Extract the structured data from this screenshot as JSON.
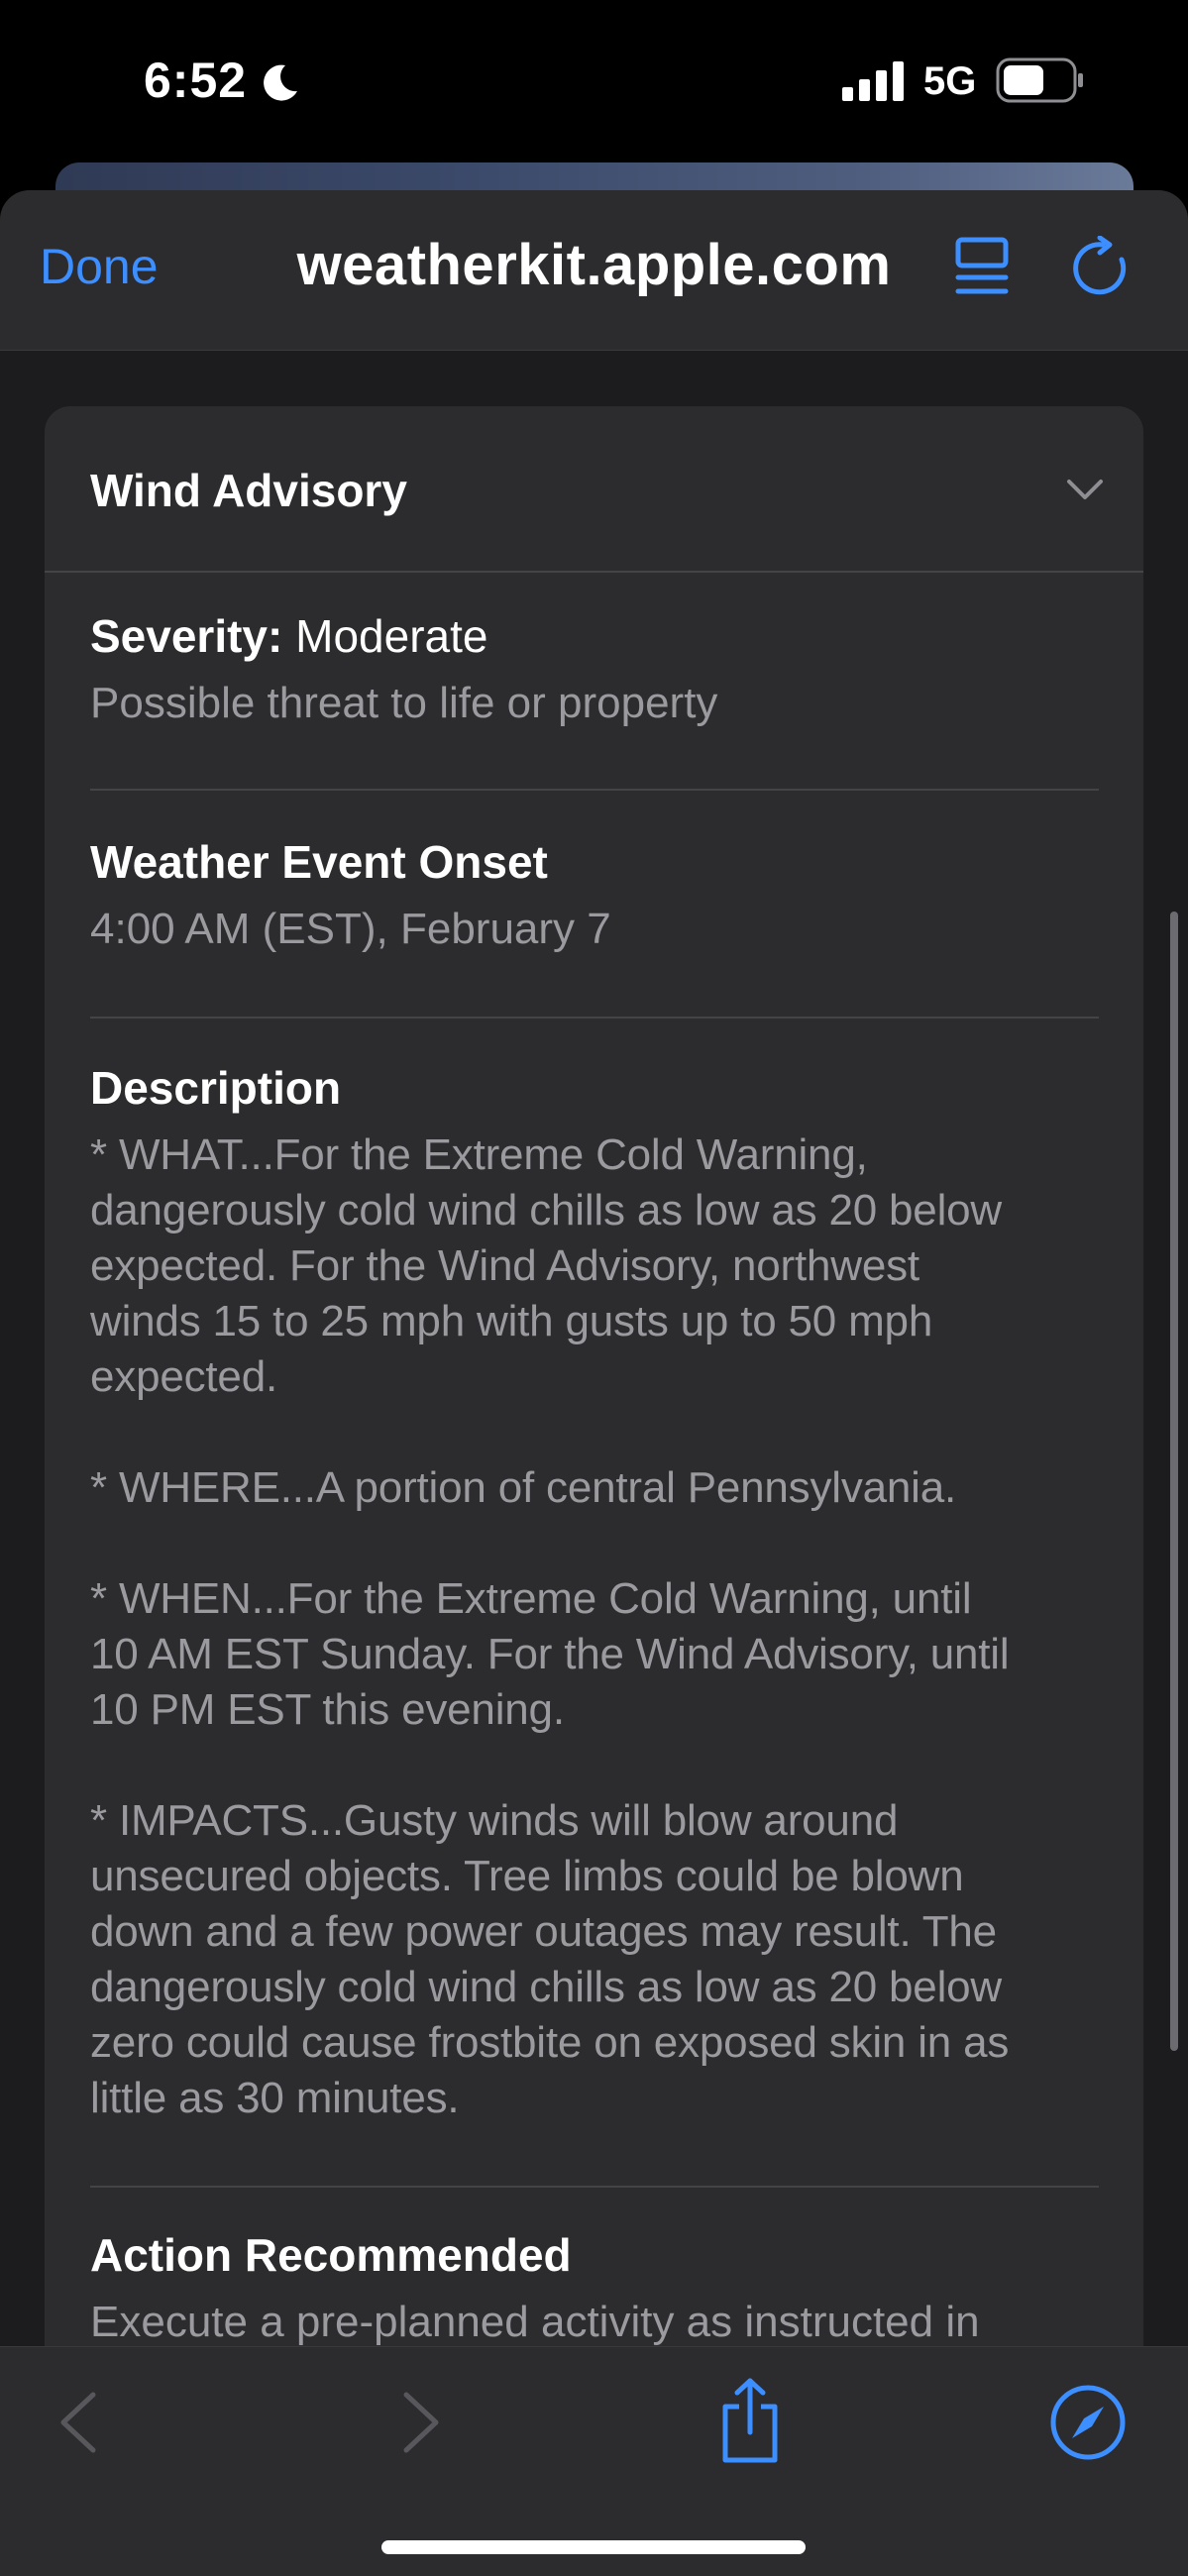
{
  "status_bar": {
    "time": "6:52",
    "network": "5G",
    "icons": [
      "moon-icon",
      "signal-icon",
      "battery-icon"
    ]
  },
  "nav": {
    "done_label": "Done",
    "url": "weatherkit.apple.com",
    "icons": [
      "reader-icon",
      "reload-icon"
    ],
    "accent_color": "#3d8eff"
  },
  "alert": {
    "title": "Wind Advisory",
    "severity_label": "Severity:",
    "severity_value": "Moderate",
    "severity_detail": "Possible threat to life or property",
    "onset_label": "Weather Event Onset",
    "onset_value": "4:00 AM (EST), February 7",
    "description_label": "Description",
    "description_text": "* WHAT...For the Extreme Cold Warning,\ndangerously cold wind chills as low as 20 below\nexpected. For the Wind Advisory, northwest\nwinds 15 to 25 mph with gusts up to 50 mph\nexpected.\n\n* WHERE...A portion of central Pennsylvania.\n\n* WHEN...For the Extreme Cold Warning, until\n10 AM EST Sunday. For the Wind Advisory, until\n10 PM EST this evening.\n\n* IMPACTS...Gusty winds will blow around\nunsecured objects. Tree limbs could be blown\ndown and a few power outages may result. The\ndangerously cold wind chills as low as 20 below\nzero could cause frostbite on exposed skin in as\nlittle as 30 minutes.",
    "action_label": "Action Recommended",
    "action_text_partial": "Execute a pre-planned activity as instructed in"
  },
  "toolbar": {
    "icons": [
      "back-icon",
      "forward-icon",
      "share-icon",
      "compass-icon"
    ]
  }
}
